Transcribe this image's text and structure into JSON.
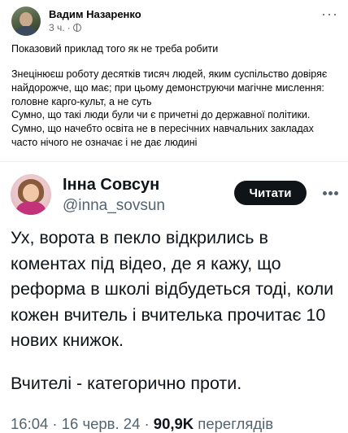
{
  "fb_post": {
    "author": "Вадим Назаренко",
    "time": "3 ч.",
    "more": "···",
    "paragraphs": [
      "Показовий приклад того як не треба робити",
      "Знецінюєш роботу десятків тисяч людей, яким суспільство довіряє найдорожче, що має; при цьому демонструючи магічне мислення: головне карго-культ, а не суть",
      "Сумно, що такі люди були чи є причетні до державної політики. Сумно, що начебто освіта не в пересічних навчальних закладах часто нічого не означає і не дає людині"
    ]
  },
  "tweet": {
    "name": "Інна Совсун",
    "handle": "@inna_sovsun",
    "follow_label": "Читати",
    "text_main": "Ух, ворота в пекло відкрились в коментах під відео, де я кажу, що реформа в школі відбудеться тоді, коли кожен вчитель і вчителька прочитає 10 нових книжок.",
    "text_second": "Вчителі - категорично проти.",
    "timestamp": "16:04 · 16 черв. 24 · ",
    "views_count": "90,9K",
    "views_label": " переглядів"
  }
}
